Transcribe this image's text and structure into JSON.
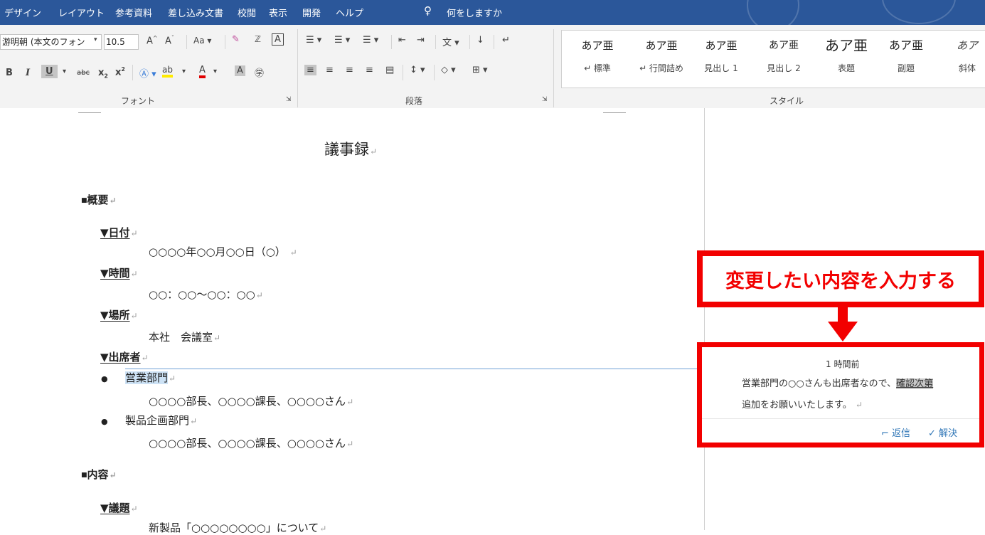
{
  "menu": {
    "items": [
      "デザイン",
      "レイアウト",
      "参考資料",
      "差し込み文書",
      "校閲",
      "表示",
      "開発",
      "ヘルプ"
    ],
    "tell_me": "何をしますか"
  },
  "ribbon": {
    "font_name": "游明朝 (本文のフォン",
    "font_size": "10.5",
    "font_case": "Aa",
    "group_font": "フォント",
    "group_paragraph": "段落",
    "group_styles": "スタイル",
    "styles": [
      {
        "preview": "あア亜",
        "label": "↵ 標準"
      },
      {
        "preview": "あア亜",
        "label": "↵ 行間詰め"
      },
      {
        "preview": "あア亜",
        "label": "見出し 1"
      },
      {
        "preview": "あア亜",
        "label": "見出し 2"
      },
      {
        "preview": "あア亜",
        "label": "表題"
      },
      {
        "preview": "あア亜",
        "label": "副題"
      },
      {
        "preview": "あア",
        "label": "斜体"
      }
    ]
  },
  "document": {
    "title": "議事録",
    "section_overview": "概要",
    "date_label": "▼日付",
    "date_value": "○○○○年○○月○○日（○）",
    "time_label": "▼時間",
    "time_value": "○○：○○～○○：○○",
    "place_label": "▼場所",
    "place_value": "本社　会議室",
    "attendees_label": "▼出席者",
    "dept1": "営業部門",
    "dept1_members": "○○○○部長、○○○○課長、○○○○さん",
    "dept2": "製品企画部門",
    "dept2_members": "○○○○部長、○○○○課長、○○○○さん",
    "section_content": "内容",
    "agenda_label": "▼議題",
    "agenda_value": "新製品「○○○○○○○○」について"
  },
  "comment": {
    "time": "1 時間前",
    "line1_before": "営業部門の○○さんも出席者なので、",
    "line1_highlight": "確認次第",
    "line2": "追加をお願いいたします。",
    "reply": "返信",
    "resolve": "解決"
  },
  "annotation": {
    "callout_text": "変更したい内容を入力する",
    "color": "#f20000"
  }
}
